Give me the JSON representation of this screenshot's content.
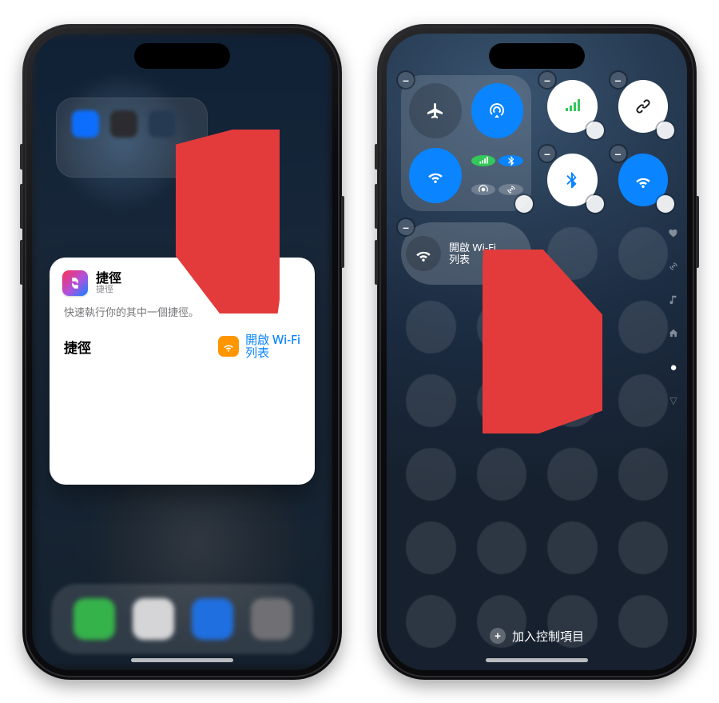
{
  "left": {
    "widget": {
      "app_title": "捷徑",
      "app_subtitle": "捷徑",
      "description": "快速執行你的其中一個捷徑。",
      "row_label": "捷徑",
      "action_line1": "開啟 Wi-Fi",
      "action_line2": "列表",
      "icon_name": "wifi-icon"
    }
  },
  "right": {
    "connectivity": {
      "airplane": "airplane-icon",
      "airdrop": "airdrop-icon",
      "wifi": "wifi-icon",
      "cell": "cellular-icon",
      "bt": "bluetooth-icon",
      "hotspot": "hotspot-icon",
      "satellite": "satellite-icon"
    },
    "tiles": {
      "signal_icon": "cellular-icon",
      "focus_icon": "focus-link-icon",
      "bluetooth_icon": "bluetooth-icon",
      "wifi_icon": "wifi-icon"
    },
    "shortcut_tile": {
      "icon": "wifi-icon",
      "line1": "開啟 Wi-Fi",
      "line2": "列表"
    },
    "side_indicators": [
      "heart",
      "broadcast",
      "music",
      "home",
      "dot",
      "chevron"
    ],
    "footer": {
      "add_label": "加入控制項目",
      "plus": "+"
    }
  },
  "colors": {
    "accent_blue": "#0a84ff",
    "accent_green": "#34c759",
    "arrow": "#e33b3b",
    "wifi_chip": "#ff9500"
  }
}
